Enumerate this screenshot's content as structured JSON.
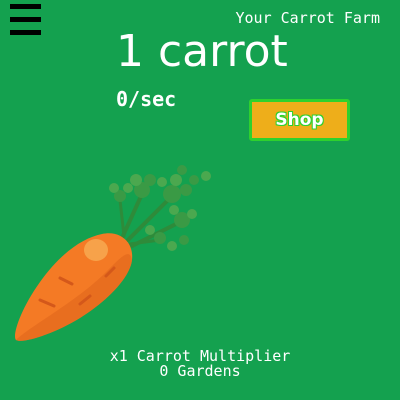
{
  "header": {
    "menu_icon": "hamburger-menu-icon",
    "farm_title": "Your Carrot Farm"
  },
  "counter": {
    "carrots": "1 carrot",
    "rate": "0/sec"
  },
  "shop": {
    "label": "Shop"
  },
  "carrot": {
    "icon": "carrot-icon"
  },
  "stats": {
    "multiplier": "x1 Carrot Multiplier",
    "gardens": "0 Gardens"
  },
  "colors": {
    "background": "#14a14f",
    "shop_fill": "#eeae1a",
    "shop_border": "#2ed12e",
    "carrot_orange": "#f47a25",
    "leaf_green": "#2e8b3a"
  }
}
